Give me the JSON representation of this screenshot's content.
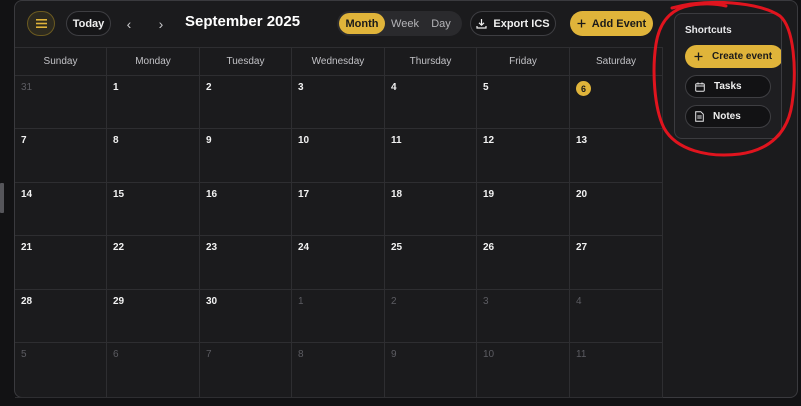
{
  "toolbar": {
    "today_label": "Today",
    "prev_icon": "‹",
    "next_icon": "›",
    "title": "September 2025",
    "views": [
      "Month",
      "Week",
      "Day"
    ],
    "active_view": "Month",
    "export_label": "Export ICS",
    "add_label": "Add Event"
  },
  "calendar": {
    "weekdays": [
      "Sunday",
      "Monday",
      "Tuesday",
      "Wednesday",
      "Thursday",
      "Friday",
      "Saturday"
    ],
    "today": "6",
    "weeks": [
      [
        {
          "d": "31",
          "out": true
        },
        {
          "d": "1"
        },
        {
          "d": "2"
        },
        {
          "d": "3"
        },
        {
          "d": "4"
        },
        {
          "d": "5"
        },
        {
          "d": "6",
          "today": true
        }
      ],
      [
        {
          "d": "7"
        },
        {
          "d": "8"
        },
        {
          "d": "9"
        },
        {
          "d": "10"
        },
        {
          "d": "11"
        },
        {
          "d": "12"
        },
        {
          "d": "13"
        }
      ],
      [
        {
          "d": "14"
        },
        {
          "d": "15"
        },
        {
          "d": "16"
        },
        {
          "d": "17"
        },
        {
          "d": "18"
        },
        {
          "d": "19"
        },
        {
          "d": "20"
        }
      ],
      [
        {
          "d": "21"
        },
        {
          "d": "22"
        },
        {
          "d": "23"
        },
        {
          "d": "24"
        },
        {
          "d": "25"
        },
        {
          "d": "26"
        },
        {
          "d": "27"
        }
      ],
      [
        {
          "d": "28"
        },
        {
          "d": "29"
        },
        {
          "d": "30"
        },
        {
          "d": "1",
          "out": true
        },
        {
          "d": "2",
          "out": true
        },
        {
          "d": "3",
          "out": true
        },
        {
          "d": "4",
          "out": true
        }
      ],
      [
        {
          "d": "5",
          "out": true
        },
        {
          "d": "6",
          "out": true
        },
        {
          "d": "7",
          "out": true
        },
        {
          "d": "8",
          "out": true
        },
        {
          "d": "9",
          "out": true
        },
        {
          "d": "10",
          "out": true
        },
        {
          "d": "11",
          "out": true
        }
      ]
    ]
  },
  "shortcuts": {
    "title": "Shortcuts",
    "create_label": "Create event",
    "tasks_label": "Tasks",
    "notes_label": "Notes"
  },
  "colors": {
    "accent": "#e0b43a",
    "background": "#1b1b1d",
    "annotation": "#e0141e"
  },
  "icons": {
    "menu": "hamburger-icon",
    "export": "download-icon",
    "add": "plus-icon",
    "tasks": "calendar-icon",
    "notes": "document-icon"
  }
}
